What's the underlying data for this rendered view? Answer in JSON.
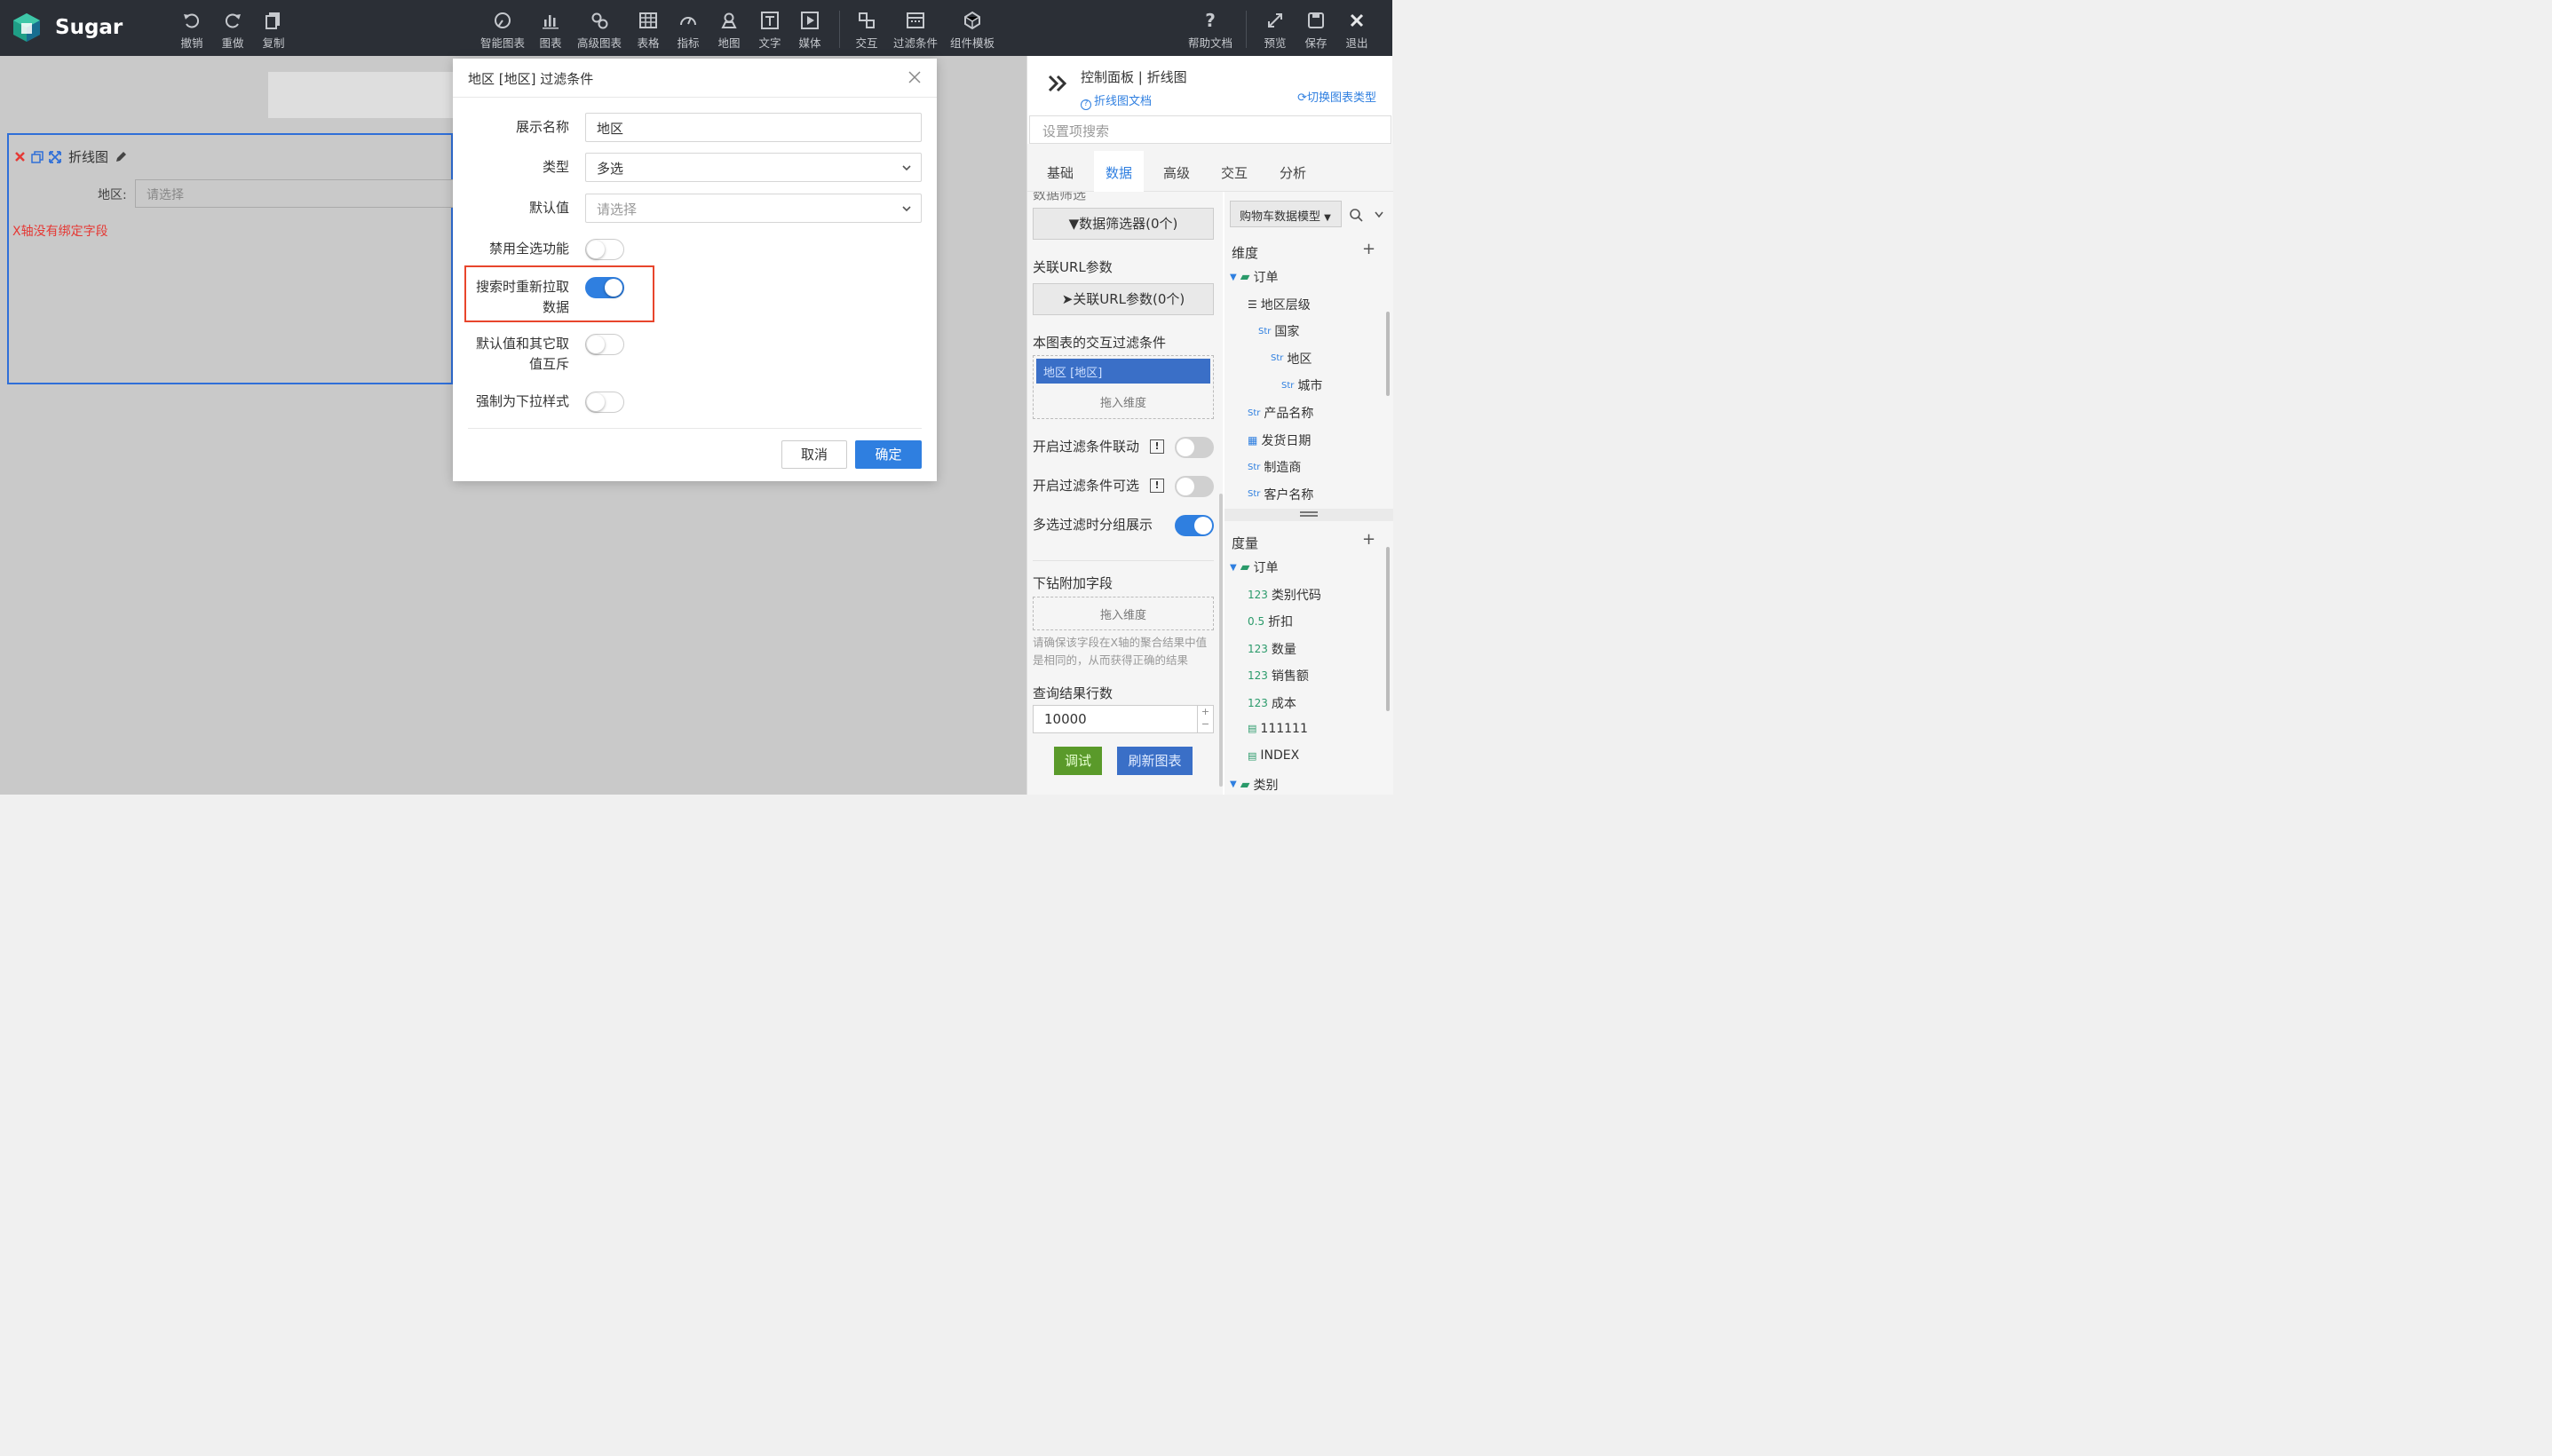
{
  "app": {
    "brand": "Sugar"
  },
  "toolbar": {
    "left": [
      "撤销",
      "重做",
      "复制"
    ],
    "center": [
      "智能图表",
      "图表",
      "高级图表",
      "表格",
      "指标",
      "地图",
      "文字",
      "媒体"
    ],
    "center2": [
      "交互",
      "过滤条件",
      "组件模板"
    ],
    "right": [
      "帮助文档",
      "预览",
      "保存",
      "退出"
    ]
  },
  "widget": {
    "title": "折线图",
    "filter_label": "地区:",
    "filter_placeholder": "请选择",
    "error": "X轴没有绑定字段"
  },
  "modal": {
    "title": "地区 [地区] 过滤条件",
    "fields": {
      "display_name_label": "展示名称",
      "display_name_value": "地区",
      "type_label": "类型",
      "type_value": "多选",
      "default_label": "默认值",
      "default_placeholder": "请选择",
      "disable_select_all_label": "禁用全选功能",
      "refetch_label_1": "搜索时重新拉取",
      "refetch_label_2": "数据",
      "mutex_label_1": "默认值和其它取",
      "mutex_label_2": "值互斥",
      "force_dropdown_label": "强制为下拉样式"
    },
    "toggles": {
      "disable_select_all": false,
      "refetch_on_search": true,
      "mutex": false,
      "force_dropdown": false
    },
    "cancel": "取消",
    "ok": "确定"
  },
  "panel": {
    "header": "控制面板 | 折线图",
    "doc_link": "折线图文档",
    "switch_type": "切换图表类型",
    "search_placeholder": "设置项搜索",
    "tabs": [
      "基础",
      "数据",
      "高级",
      "交互",
      "分析"
    ],
    "active_tab": "数据",
    "left": {
      "cut_label": "数据筛选",
      "data_filter_btn": "数据筛选器(0个)",
      "url_param_label": "关联URL参数",
      "url_param_btn": "关联URL参数(0个)",
      "interaction_label": "本图表的交互过滤条件",
      "chip": "地区 [地区]",
      "drop_dim": "拖入维度",
      "toggle1_label": "开启过滤条件联动",
      "toggle2_label": "开启过滤条件可选",
      "toggle3_label": "多选过滤时分组展示",
      "toggle_states": [
        false,
        false,
        true
      ],
      "drill_label": "下钻附加字段",
      "drop_dim2": "拖入维度",
      "hint": "请确保该字段在X轴的聚合结果中值是相同的，从而获得正确的结果",
      "rows_label": "查询结果行数",
      "rows_value": "10000",
      "debug_btn": "调试",
      "refresh_btn": "刷新图表"
    },
    "right": {
      "model": "购物车数据模型",
      "dim_header": "维度",
      "dims": [
        {
          "label": "订单",
          "kind": "folder",
          "indent": 0
        },
        {
          "label": "地区层级",
          "kind": "hier",
          "indent": 1
        },
        {
          "label": "国家",
          "kind": "Str",
          "indent": 2
        },
        {
          "label": "地区",
          "kind": "Str",
          "indent": 3
        },
        {
          "label": "城市",
          "kind": "Str",
          "indent": 4
        },
        {
          "label": "产品名称",
          "kind": "Str",
          "indent": 1
        },
        {
          "label": "发货日期",
          "kind": "date",
          "indent": 1
        },
        {
          "label": "制造商",
          "kind": "Str",
          "indent": 1
        },
        {
          "label": "客户名称",
          "kind": "Str",
          "indent": 1
        }
      ],
      "measure_header": "度量",
      "measures": [
        {
          "label": "订单",
          "kind": "folder"
        },
        {
          "label": "类别代码",
          "kind": "123"
        },
        {
          "label": "折扣",
          "kind": "0.5"
        },
        {
          "label": "数量",
          "kind": "123"
        },
        {
          "label": "销售额",
          "kind": "123"
        },
        {
          "label": "成本",
          "kind": "123"
        },
        {
          "label": "111111",
          "kind": "calc"
        },
        {
          "label": "INDEX",
          "kind": "calc"
        },
        {
          "label": "类别",
          "kind": "folder"
        }
      ]
    }
  },
  "colors": {
    "accent": "#2f7fe0",
    "topbar": "#2b2f36",
    "highlight": "#e8452c",
    "error": "#e53935"
  }
}
